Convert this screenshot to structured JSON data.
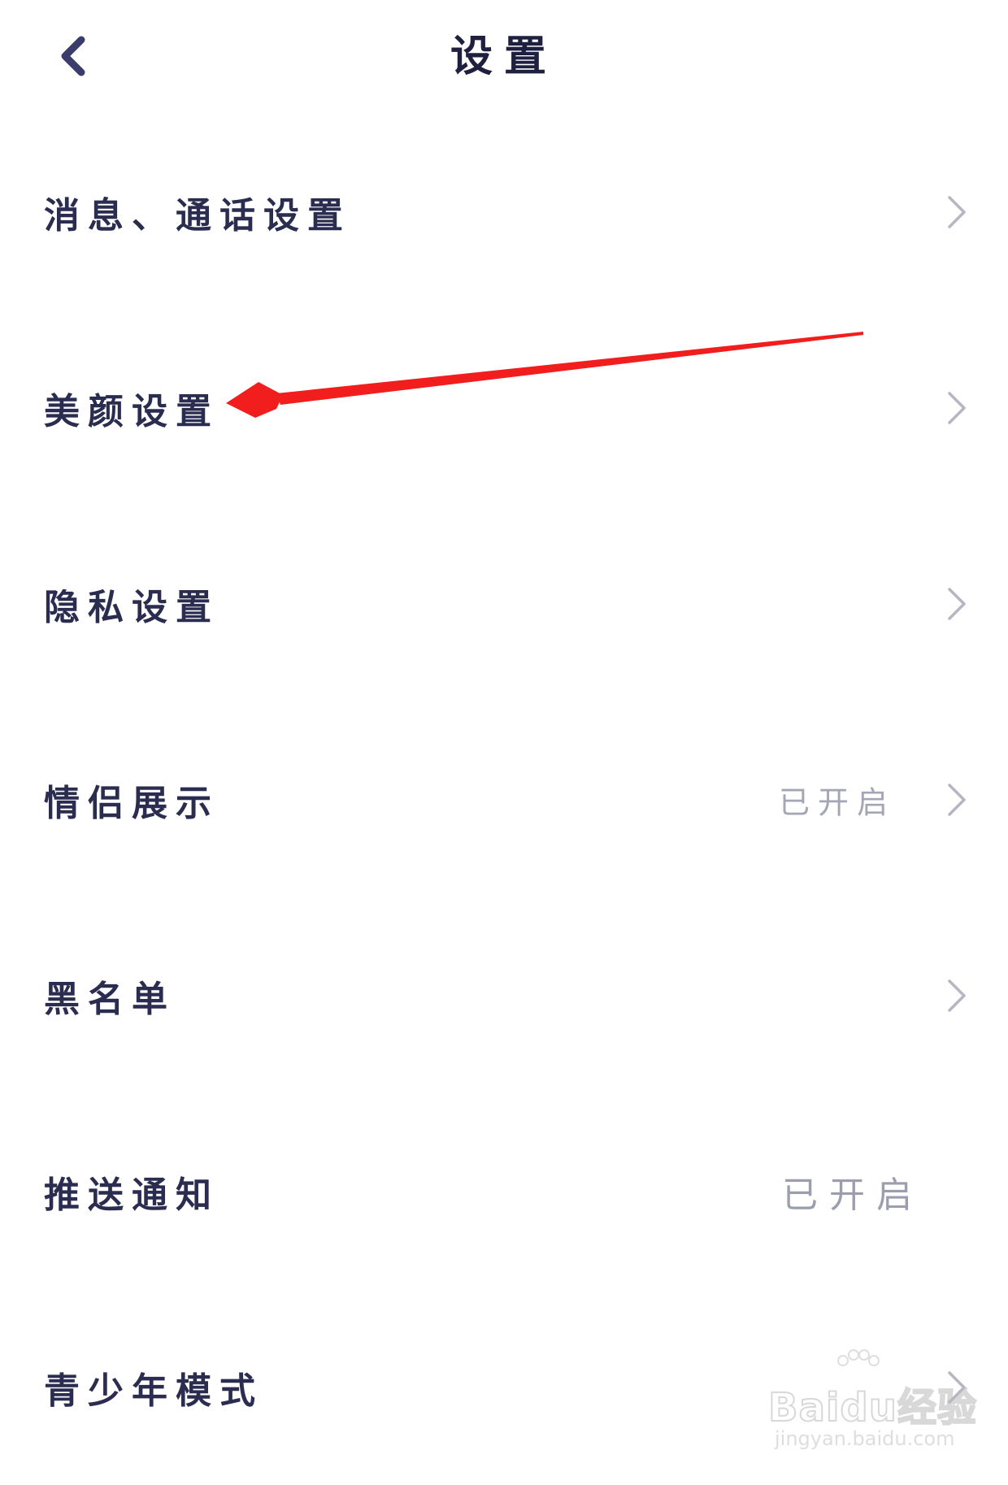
{
  "header": {
    "title": "设置",
    "back_icon": "chevron-left-icon"
  },
  "settings": [
    {
      "key": "message-call",
      "label": "消息、通话设置",
      "status": "",
      "chevron": true
    },
    {
      "key": "beauty",
      "label": "美颜设置",
      "status": "",
      "chevron": true
    },
    {
      "key": "privacy",
      "label": "隐私设置",
      "status": "",
      "chevron": true
    },
    {
      "key": "couple-display",
      "label": "情侣展示",
      "status": "已开启",
      "chevron": true
    },
    {
      "key": "blacklist",
      "label": "黑名单",
      "status": "",
      "chevron": true
    },
    {
      "key": "push-notification",
      "label": "推送通知",
      "status": "已开启",
      "chevron": false
    },
    {
      "key": "teen-mode",
      "label": "青少年模式",
      "status": "",
      "chevron": true
    }
  ],
  "watermark": {
    "brand": "Baidu经验",
    "url": "jingyan.baidu.com"
  },
  "colors": {
    "text": "#2b2d50",
    "status_text": "#a4a6b6",
    "chevron": "#b5b6c2",
    "annotation_arrow": "#f21d1d"
  }
}
